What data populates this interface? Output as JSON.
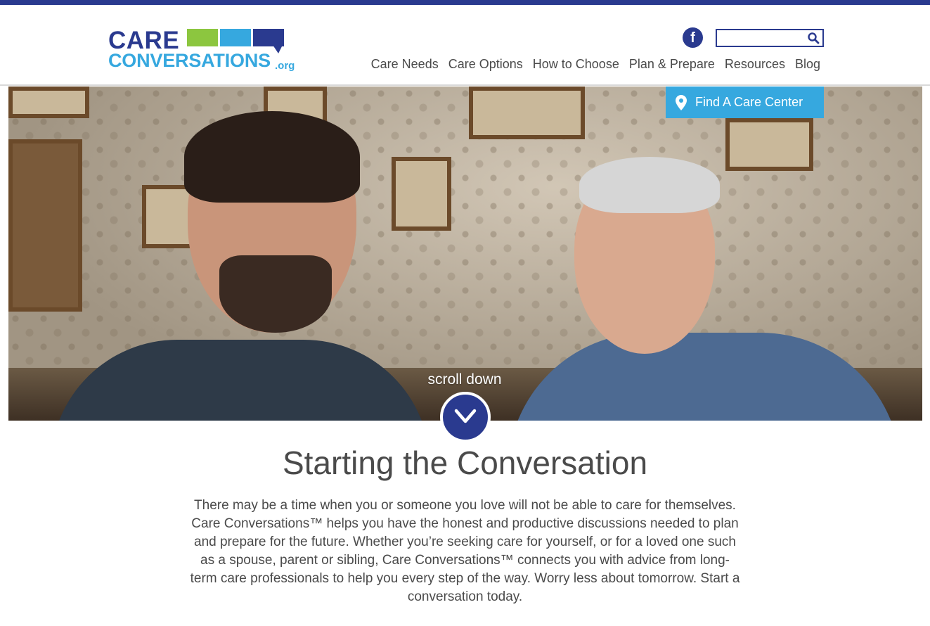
{
  "logo": {
    "line1": "CARE",
    "line2": "CONVERSATIONS",
    "suffix": ".org"
  },
  "header": {
    "facebook_glyph": "f",
    "search": {
      "placeholder": "",
      "value": ""
    }
  },
  "nav": {
    "items": [
      {
        "label": "Care Needs"
      },
      {
        "label": "Care Options"
      },
      {
        "label": "How to Choose"
      },
      {
        "label": "Plan & Prepare"
      },
      {
        "label": "Resources"
      },
      {
        "label": "Blog"
      }
    ]
  },
  "hero": {
    "find_button_label": "Find A Care Center",
    "scroll_label": "scroll down"
  },
  "main": {
    "title": "Starting the Conversation",
    "intro": "There may be a time when you or someone you love will not be able to care for themselves. Care Conversations™ helps you have the honest and productive discussions needed to plan and prepare for the future. Whether you’re seeking care for yourself, or for a loved one such as a spouse, parent or sibling, Care Conversations™ connects you with advice from long-term care professionals to help you every step of the way. Worry less about tomorrow. Start a conversation today."
  },
  "colors": {
    "navy": "#2a3a8f",
    "sky": "#36a8df",
    "green": "#8cc63f",
    "text": "#4a4a4a"
  },
  "icons": [
    "facebook-icon",
    "search-icon",
    "map-pin-icon",
    "chevron-down-icon"
  ]
}
